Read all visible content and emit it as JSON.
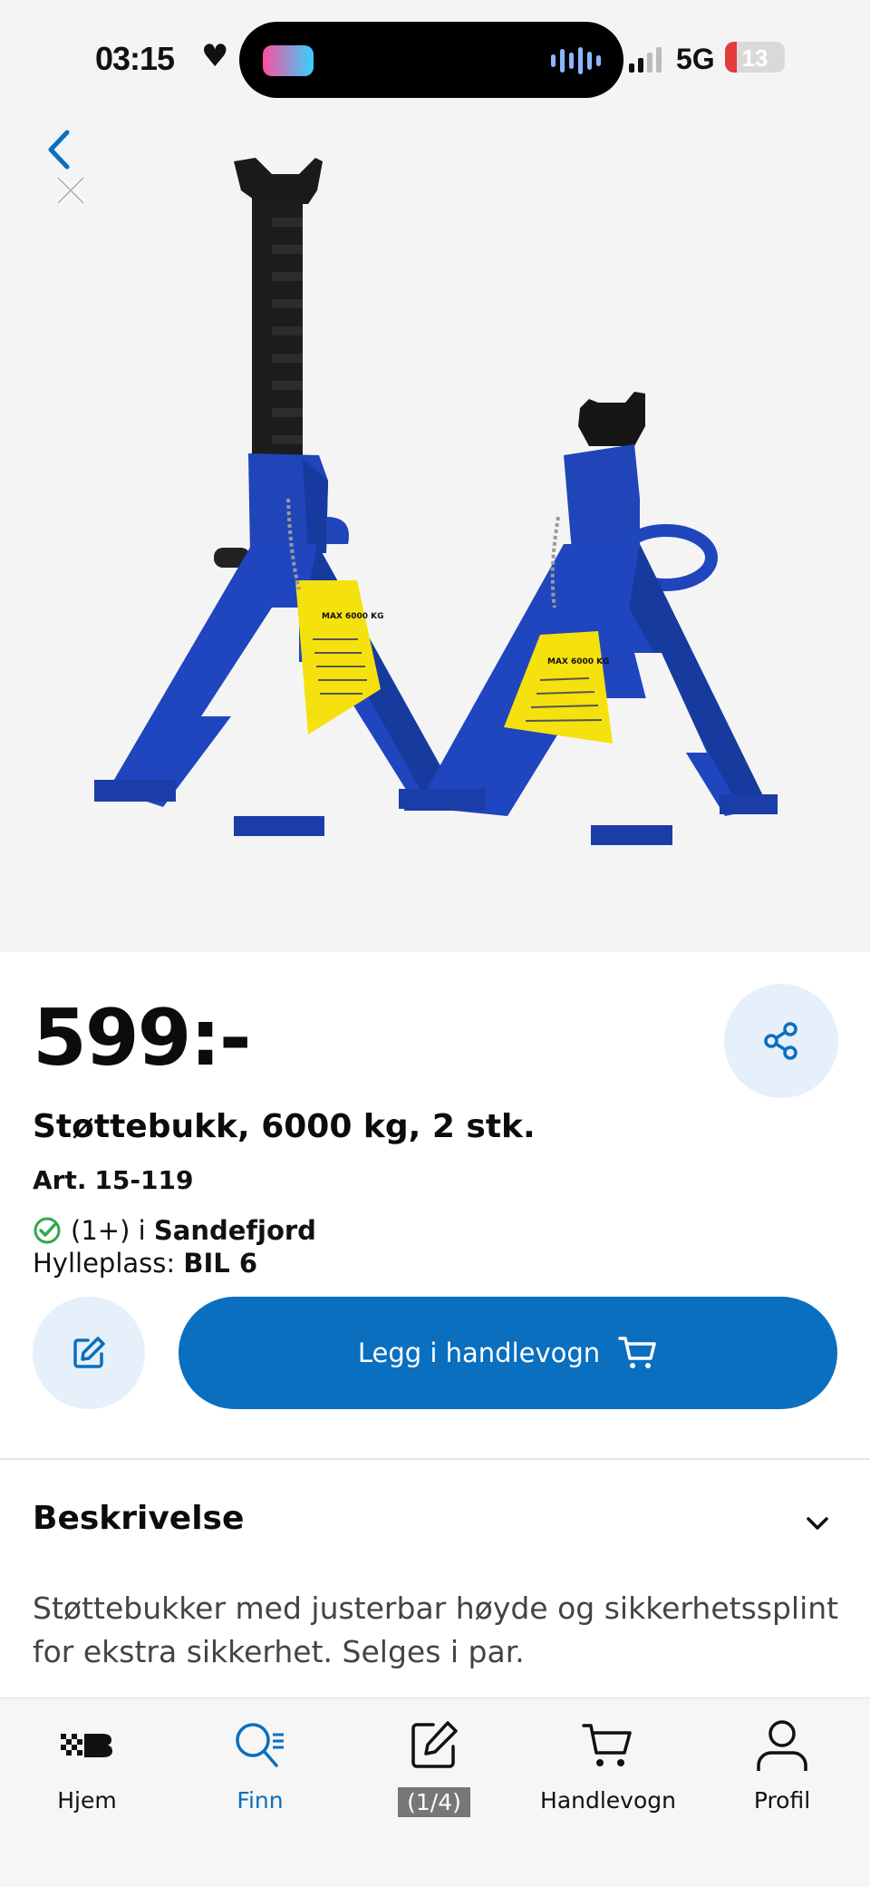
{
  "status_bar": {
    "time": "03:15",
    "network": "5G",
    "battery": "13"
  },
  "product": {
    "price": "599:-",
    "title": "Støttebukk, 6000 kg, 2 stk.",
    "art_label": "Art.",
    "art_number": "15-119",
    "stock_count": "(1+) i",
    "store": "Sandefjord",
    "shelf_label": "Hylleplass:",
    "shelf_value": "BIL 6",
    "image_labels": {
      "left": "MAX 6000 KG",
      "right": "MAX 6000 KG"
    }
  },
  "actions": {
    "add_to_cart": "Legg i handlevogn"
  },
  "description": {
    "heading": "Beskrivelse",
    "text": "Støttebukker med justerbar høyde og sikkerhetssplint for ekstra sikkerhet. Selges i par."
  },
  "tabbar": {
    "items": [
      {
        "label": "Hjem",
        "icon": "logo-icon"
      },
      {
        "label": "Finn",
        "icon": "search-icon"
      },
      {
        "label": "(1/4)",
        "icon": "note-icon"
      },
      {
        "label": "Handlevogn",
        "icon": "cart-icon"
      },
      {
        "label": "Profil",
        "icon": "user-icon"
      }
    ],
    "active": "Finn"
  },
  "colors": {
    "brand_blue": "#0a6fbf",
    "light_blue": "#e6f0fa",
    "success_green": "#2fa84f"
  }
}
